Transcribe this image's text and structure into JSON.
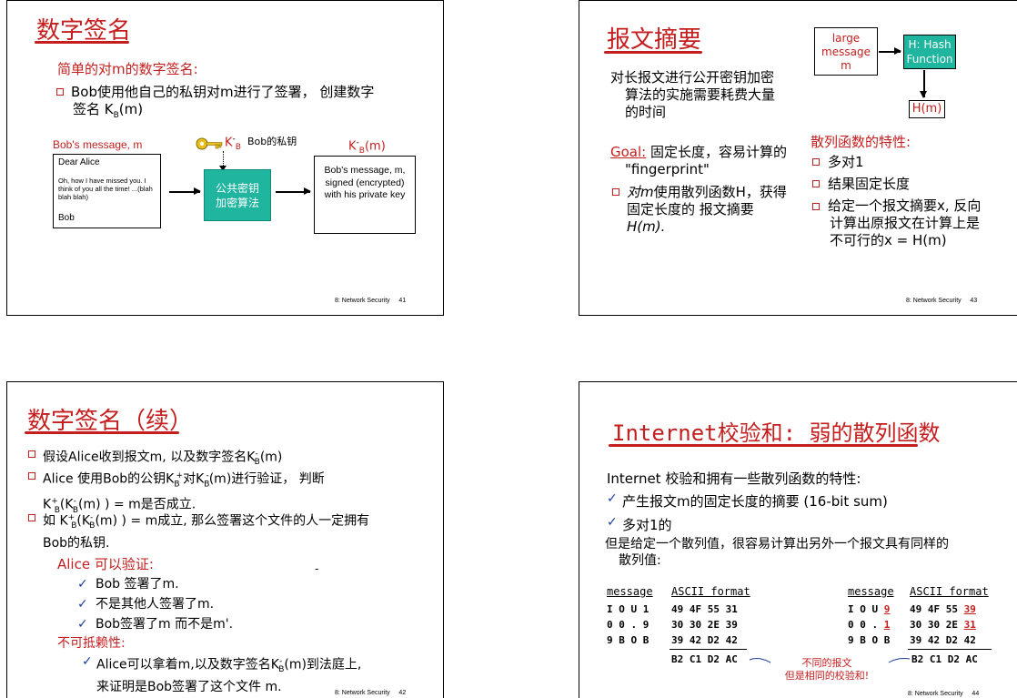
{
  "slide41": {
    "title": "数字签名",
    "subtitle": "简单的对m的数字签名:",
    "bullet1_line1": "Bob使用他自己的私钥对m进行了签署，  创建数字",
    "bullet1_line2_pre": "签名 K",
    "bullet1_line2_sub": "B",
    "bullet1_line2_post": "(m)",
    "msg_label": "Bob's message, m",
    "key_k": "K",
    "key_sub": "B",
    "key_sup": "-",
    "key_label": "Bob的私钥",
    "out_k": "K",
    "out_sub": "B",
    "out_sup": "-",
    "out_m": "(m)",
    "letter_greeting": "Dear Alice",
    "letter_body": "Oh, how I have missed you. I think of you all the time! ...(blah blah blah)",
    "letter_sign": "Bob",
    "alg_line1": "公共密钥",
    "alg_line2": "加密算法",
    "result_text": "Bob's message, m, signed (encrypted) with his private key",
    "footer": "8: Network Security",
    "page": "41"
  },
  "slide43": {
    "title": "报文摘要",
    "p1_line1": "对长报文进行公开密钥加密",
    "p1_line2": "算法的实施需要耗费大量",
    "p1_line3": "的时间",
    "goal_label": "Goal:",
    "goal_line1": " 固定长度，容易计算的",
    "goal_line2": "\"fingerprint\"",
    "b1_line1_pre": "对",
    "b1_line1_m": "m",
    "b1_line1_post": "使用散列函数H，获得",
    "b1_line2": "固定长度的 报文摘要",
    "b1_line3": "H(m).",
    "large_msg": "large message m",
    "hash_fn": "H: Hash Function",
    "hm": "H(m)",
    "props_title": "散列函数的特性:",
    "prop1": "多对1",
    "prop2": "结果固定长度",
    "prop3_line1": "给定一个报文摘要x, 反向",
    "prop3_line2": "计算出原报文在计算上是",
    "prop3_line3": "不可行的x = H(m)",
    "footer": "8: Network Security",
    "page": "43"
  },
  "slide42": {
    "title": "数字签名（续）",
    "b1_pre": "假设Alice收到报文m, 以及数字签名K",
    "b1_sub": "B",
    "b1_sup": "-",
    "b1_post": "(m)",
    "b2_line1": "Alice 使用Bob的公钥K",
    "b2_line1_sub": "B",
    "b2_line1_sup": "+",
    "b2_line1_post": "对K",
    "b2_line1_post_sub": "B",
    "b2_line1_post_sup": "-",
    "b2_line1_tail": "(m)进行验证，   判断",
    "b2_line2": "K",
    "b2_line2_sub": "B",
    "b2_line2_sup": "+",
    "b2_line2_mid": "(K",
    "b2_line2_mid_sub": "B",
    "b2_line2_mid_sup": "-",
    "b2_line2_tail": "(m) ) = m是否成立.",
    "b3_line1_pre": "如 K",
    "b3_line1_sub": "B",
    "b3_line1_sup": "+",
    "b3_line1_mid": "(K",
    "b3_line1_mid_sub": "B",
    "b3_line1_mid_sup": "-",
    "b3_line1_tail": "(m) ) = m成立, 那么签署这个文件的人一定拥有",
    "b3_line2": "Bob的私钥.",
    "verify_title": "Alice 可以验证:",
    "v1": "Bob 签署了m.",
    "v2": "不是其他人签署了m.",
    "v3": "Bob签署了m 而不是m'.",
    "nonrep_title": "不可抵赖性:",
    "n1_pre": "Alice可以拿着m,以及数字签名K",
    "n1_sub": "B",
    "n1_sup": "-",
    "n1_post": "(m)到法庭上,",
    "n1_line2": "来证明是Bob签署了这个文件 m.",
    "dash": "-",
    "footer": "8: Network Security",
    "page": "42"
  },
  "slide44": {
    "title": "Internet校验和: 弱的散列函数",
    "intro": "Internet 校验和拥有一些散列函数的特性:",
    "c1": "产生报文m的固定长度的摘要 (16-bit sum)",
    "c2": "多对1的",
    "p_line1": "但是给定一个散列值，很容易计算出另外一个报文具有同样的",
    "p_line2": "散列值:",
    "hdr_message": "message",
    "hdr_ascii": "ASCII format",
    "left_rows": [
      {
        "msg": "I O U 1",
        "hex": "49 4F 55 31"
      },
      {
        "msg": "0 0 . 9",
        "hex": "30 30 2E 39"
      },
      {
        "msg": "9 B O B",
        "hex": "39 42 D2 42"
      }
    ],
    "left_sum": "B2 C1 D2 AC",
    "right_rows": [
      {
        "msg_pre": "I O U ",
        "msg_red": "9",
        "hex_pre": "49 4F 55 ",
        "hex_red": "39"
      },
      {
        "msg_pre": "0 0 . ",
        "msg_red": "1",
        "hex_pre": "30 30 2E ",
        "hex_red": "31"
      },
      {
        "msg_pre": "9 B O B",
        "msg_red": "",
        "hex_pre": "39 42 D2 42",
        "hex_red": ""
      }
    ],
    "right_sum": "B2 C1 D2 AC",
    "note_line1": "不同的报文",
    "note_line2": "但是相同的校验和!",
    "footer": "8: Network Security",
    "page": "44"
  },
  "colors": {
    "accent_red": "#c41e1e",
    "teal": "#1fb59f",
    "bullet": "#c41e1e",
    "check": "#1a3e9a"
  }
}
